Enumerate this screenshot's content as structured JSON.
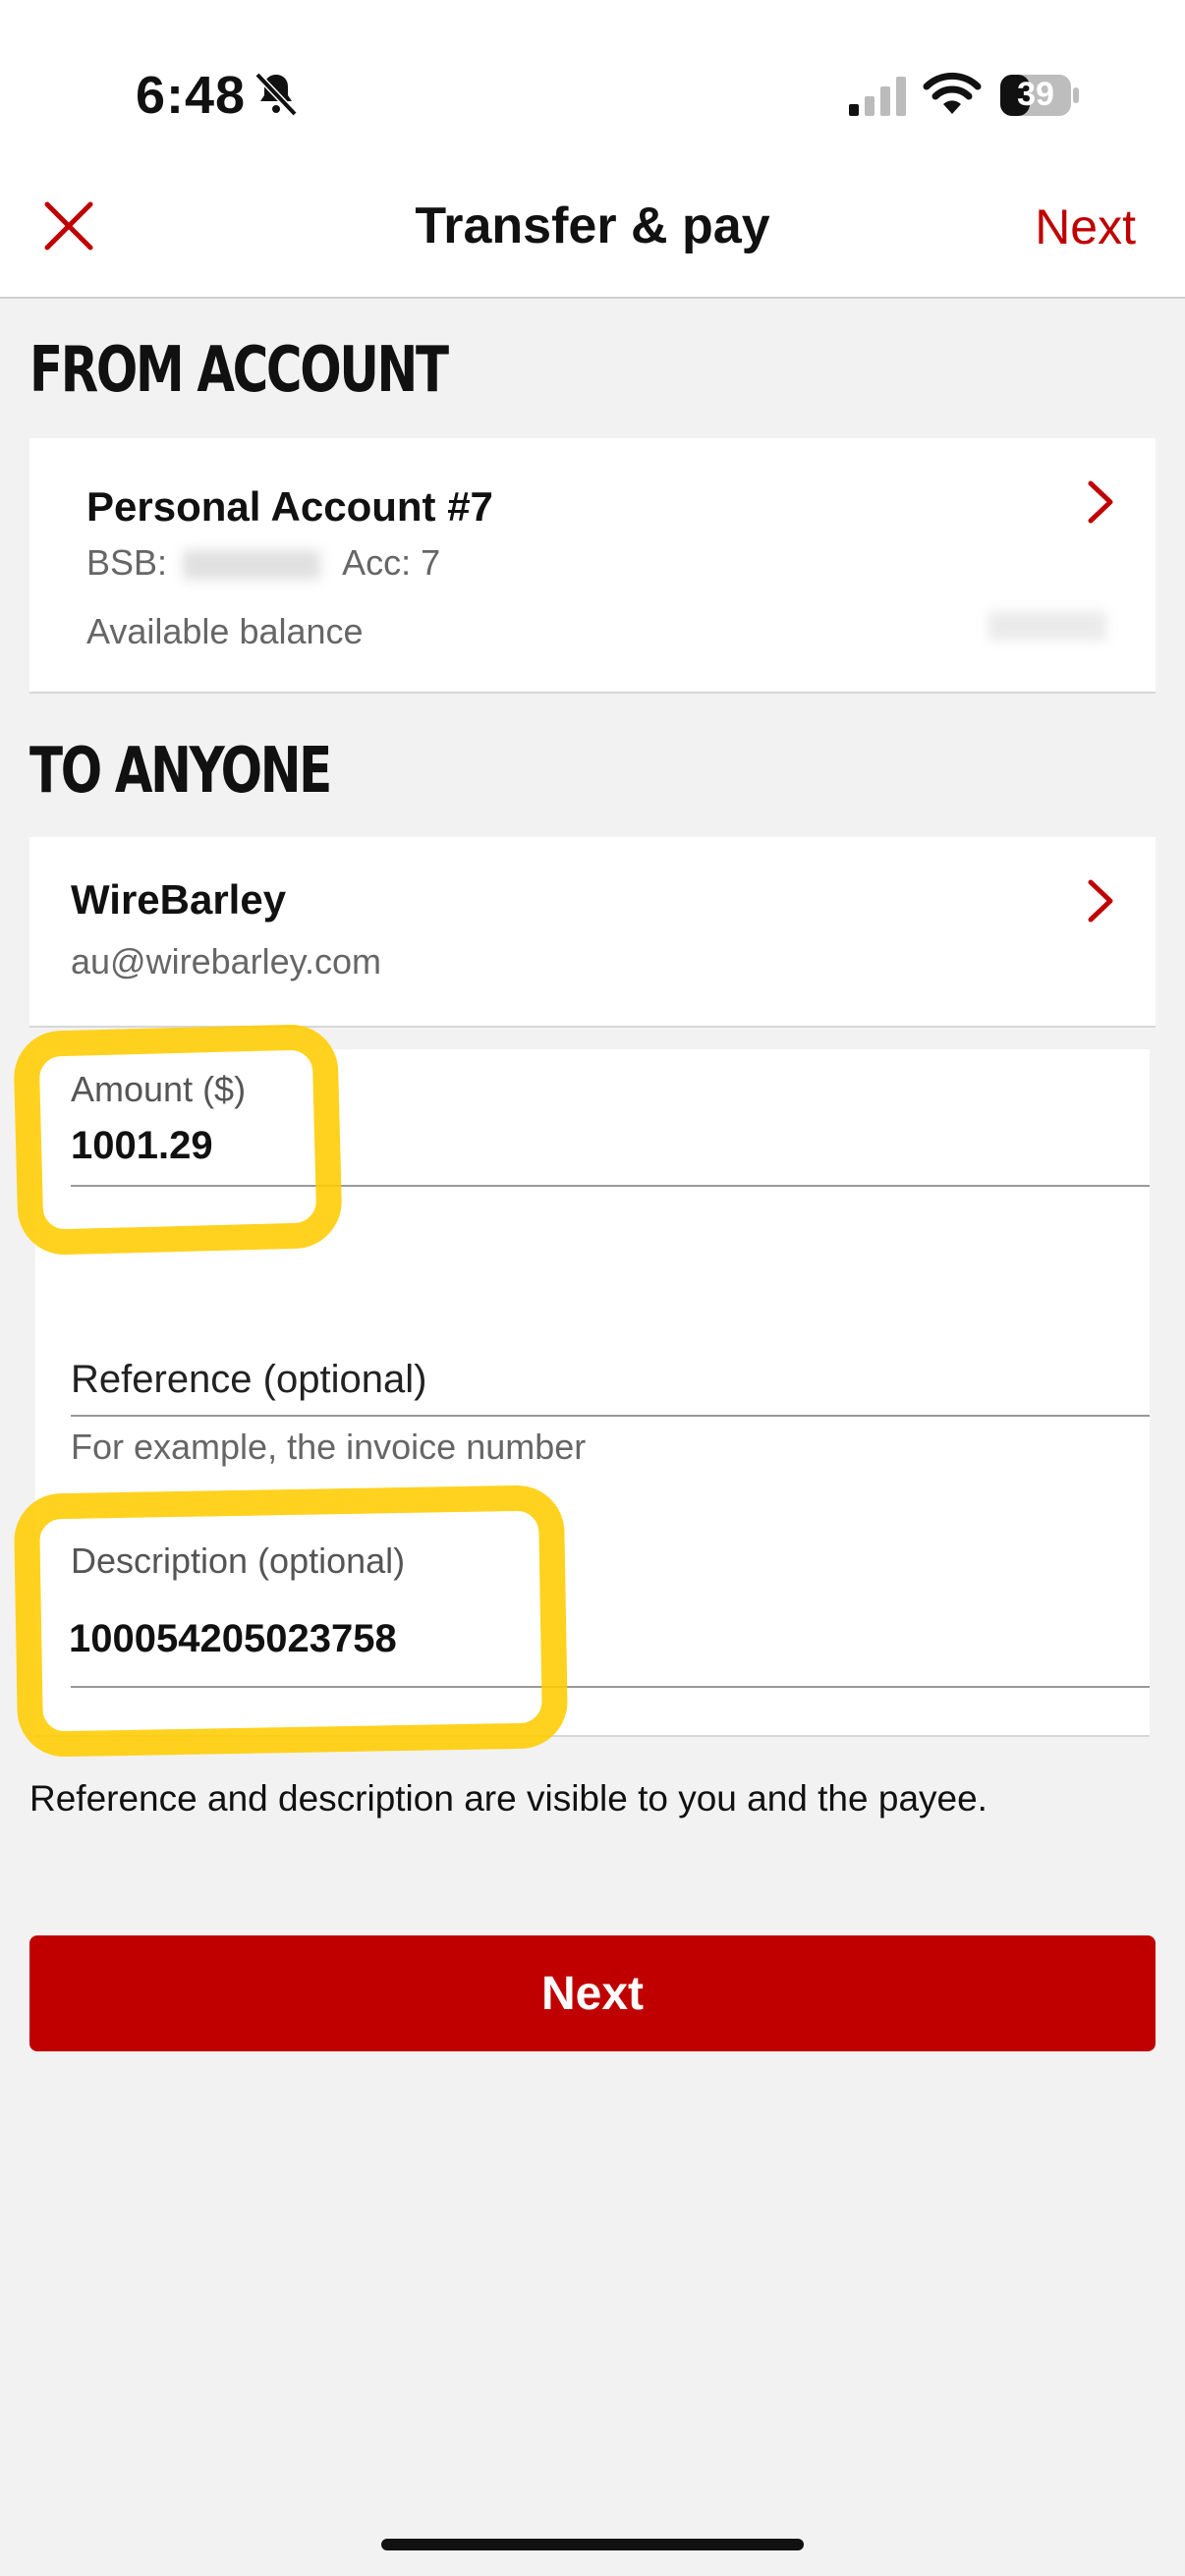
{
  "status_bar": {
    "time": "6:48",
    "battery": "39"
  },
  "nav": {
    "title": "Transfer & pay",
    "next_label": "Next"
  },
  "from_section": {
    "heading": "FROM ACCOUNT",
    "account_name": "Personal Account #7",
    "bsb_label": "BSB:",
    "acc_label": "Acc: 7",
    "available_balance_label": "Available balance"
  },
  "to_section": {
    "heading": "TO ANYONE",
    "payee_name": "WireBarley",
    "payee_email": "au@wirebarley.com"
  },
  "form": {
    "amount_label": "Amount ($)",
    "amount_value": "1001.29",
    "reference_label": "Reference (optional)",
    "reference_hint": "For example, the invoice number",
    "description_label": "Description (optional)",
    "description_value": "100054205023758"
  },
  "visibility_note": "Reference and description are visible to you and the payee.",
  "primary_button_label": "Next",
  "colors": {
    "accent": "#c00000",
    "highlight": "#ffcc00"
  }
}
